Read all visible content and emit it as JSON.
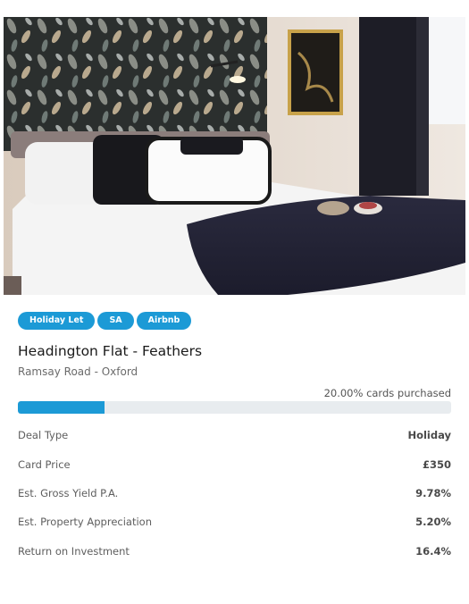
{
  "listing": {
    "tags": [
      "Holiday Let",
      "SA",
      "Airbnb"
    ],
    "title": "Headington Flat - Feathers",
    "location": "Ramsay Road - Oxford",
    "progress": {
      "label": "20.00% cards purchased",
      "fraction": 0.2,
      "color": "#1c9ad6"
    },
    "details": [
      {
        "key": "Deal Type",
        "value": "Holiday"
      },
      {
        "key": "Card Price",
        "value": "£350"
      },
      {
        "key": "Est. Gross Yield P.A.",
        "value": "9.78%"
      },
      {
        "key": "Est. Property Appreciation",
        "value": "5.20%"
      },
      {
        "key": "Return on Investment",
        "value": "16.4%"
      }
    ]
  },
  "colors": {
    "accent": "#1c9ad6",
    "track": "#e8ecef"
  }
}
